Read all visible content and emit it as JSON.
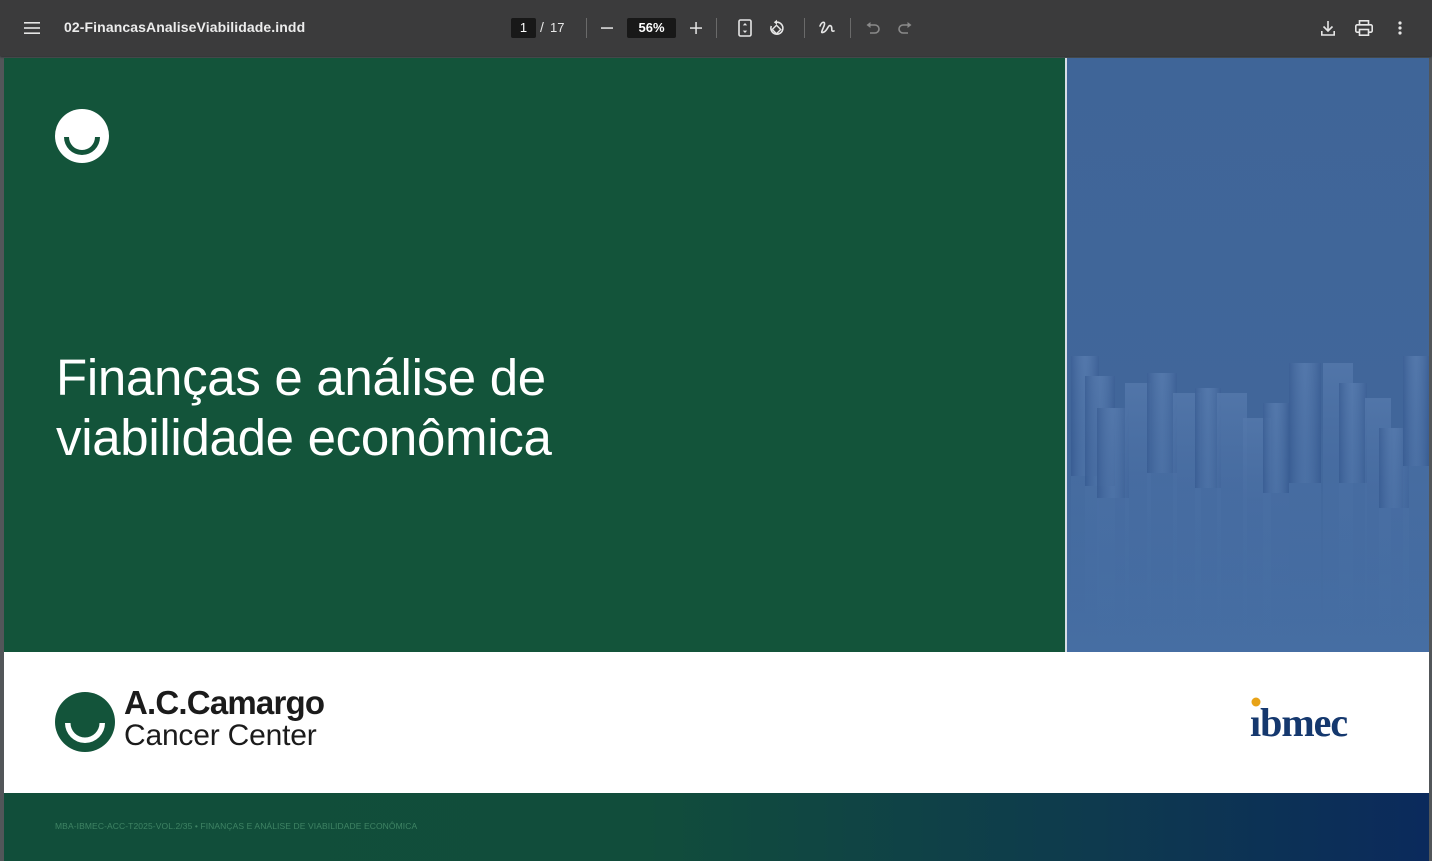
{
  "toolbar": {
    "document_title": "02-FinancasAnaliseViabilidade.indd",
    "current_page": "1",
    "page_separator": "/",
    "total_pages": "17",
    "zoom": "56%",
    "icons": [
      "menu-icon",
      "zoom-out-icon",
      "zoom-in-icon",
      "fit-page-icon",
      "rotate-icon",
      "draw-icon",
      "undo-icon",
      "redo-icon",
      "download-icon",
      "print-icon",
      "more-options-icon"
    ]
  },
  "document": {
    "cover_title_line1": "Finanças e análise de",
    "cover_title_line2": "viabilidade econômica",
    "partner_logo_name": "A.C.Camargo",
    "partner_logo_subtitle": "Cancer Center",
    "school_logo": "ibmec",
    "footer_text": "MBA-IBMEC-ACC-T2025-VOL.2/35 • FINANÇAS E ANÁLISE DE VIABILIDADE ECONÔMICA",
    "colors": {
      "green": "#13543a",
      "blue": "#41669a",
      "navy": "#0b2a5c",
      "ibmec_dot": "#e8a317"
    }
  }
}
